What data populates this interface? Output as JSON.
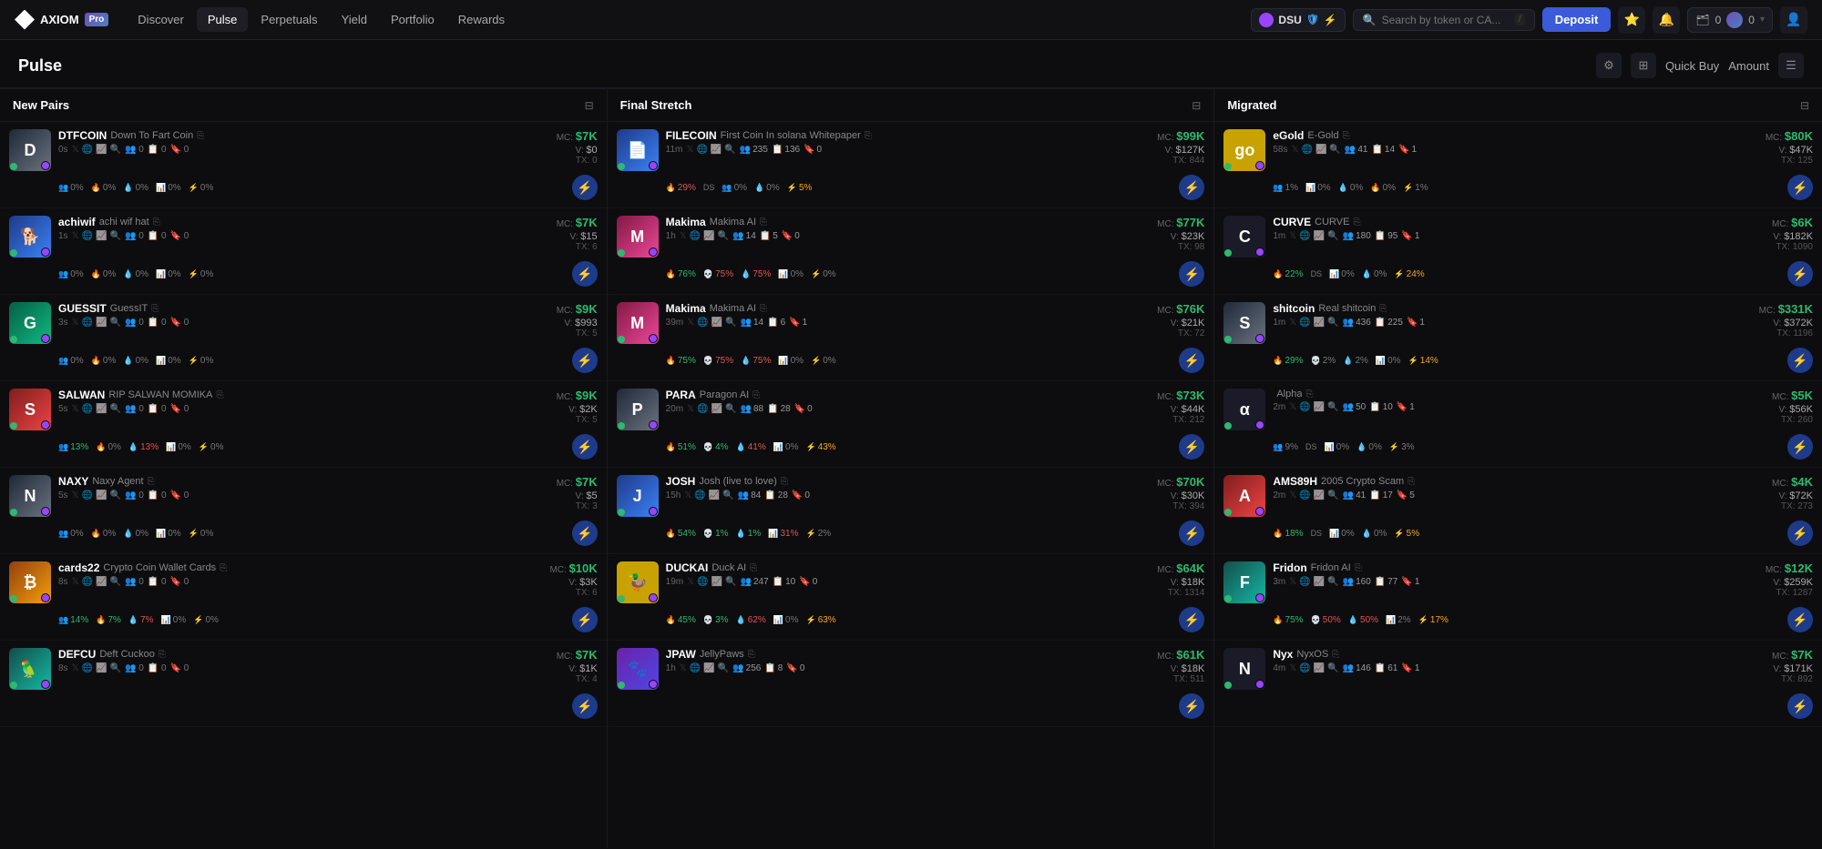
{
  "app": {
    "logo_text": "AXIOM",
    "logo_sub": "Pro",
    "nav_links": [
      "Discover",
      "Pulse",
      "Perpetuals",
      "Yield",
      "Portfolio",
      "Rewards"
    ],
    "active_nav": "Pulse",
    "chain": "DSU",
    "search_placeholder": "Search by token or CA...",
    "search_kbd": "/",
    "deposit_label": "Deposit",
    "wallet_bal1": "0",
    "wallet_bal2": "0"
  },
  "page": {
    "title": "Pulse",
    "quick_buy": "Quick Buy",
    "amount": "Amount"
  },
  "columns": [
    {
      "title": "New Pairs",
      "tokens": [
        {
          "ticker": "DTFCOIN",
          "fullname": "Down To Fart Coin",
          "time": "0s",
          "mc": "$7K",
          "vol": "$0",
          "vol_prefix": "V:",
          "tx": "TX: 0",
          "metrics": [
            {
              "icon": "👥",
              "val": "0%",
              "type": "neutral"
            },
            {
              "icon": "🔥",
              "val": "0%",
              "type": "neutral"
            },
            {
              "icon": "💧",
              "val": "0%",
              "type": "neutral"
            },
            {
              "icon": "📊",
              "val": "0%",
              "type": "neutral"
            },
            {
              "icon": "⚡",
              "val": "0%",
              "type": "neutral"
            }
          ],
          "avatar_text": "D",
          "avatar_class": "av-gray"
        },
        {
          "ticker": "achiwif",
          "fullname": "achi wif hat",
          "time": "1s",
          "mc": "$7K",
          "vol": "$15",
          "vol_prefix": "V:",
          "tx": "TX: 6",
          "metrics": [
            {
              "icon": "👥",
              "val": "0%",
              "type": "neutral"
            },
            {
              "icon": "🔥",
              "val": "0%",
              "type": "neutral"
            },
            {
              "icon": "💧",
              "val": "0%",
              "type": "neutral"
            },
            {
              "icon": "📊",
              "val": "0%",
              "type": "neutral"
            },
            {
              "icon": "⚡",
              "val": "0%",
              "type": "neutral"
            }
          ],
          "avatar_text": "🐕",
          "avatar_class": "av-blue"
        },
        {
          "ticker": "GUESSIT",
          "fullname": "GuessIT",
          "time": "3s",
          "mc": "$9K",
          "vol": "$993",
          "vol_prefix": "V:",
          "tx": "TX: 5",
          "metrics": [
            {
              "icon": "👥",
              "val": "0%",
              "type": "neutral"
            },
            {
              "icon": "🔥",
              "val": "0%",
              "type": "neutral"
            },
            {
              "icon": "💧",
              "val": "0%",
              "type": "neutral"
            },
            {
              "icon": "📊",
              "val": "0%",
              "type": "neutral"
            },
            {
              "icon": "⚡",
              "val": "0%",
              "type": "neutral"
            }
          ],
          "avatar_text": "G",
          "avatar_class": "av-green"
        },
        {
          "ticker": "SALWAN",
          "fullname": "RIP SALWAN MOMIKA",
          "time": "5s",
          "mc": "$9K",
          "vol": "$2K",
          "vol_prefix": "V:",
          "tx": "TX: 5",
          "metrics": [
            {
              "icon": "👥",
              "val": "13%",
              "type": "green"
            },
            {
              "icon": "🔥",
              "val": "0%",
              "type": "neutral"
            },
            {
              "icon": "💧",
              "val": "13%",
              "type": "red"
            },
            {
              "icon": "📊",
              "val": "0%",
              "type": "neutral"
            },
            {
              "icon": "⚡",
              "val": "0%",
              "type": "neutral"
            }
          ],
          "avatar_text": "S",
          "avatar_class": "av-red"
        },
        {
          "ticker": "NAXY",
          "fullname": "Naxy Agent",
          "time": "5s",
          "mc": "$7K",
          "vol": "$5",
          "vol_prefix": "V:",
          "tx": "TX: 3",
          "metrics": [
            {
              "icon": "👥",
              "val": "0%",
              "type": "neutral"
            },
            {
              "icon": "🔥",
              "val": "0%",
              "type": "neutral"
            },
            {
              "icon": "💧",
              "val": "0%",
              "type": "neutral"
            },
            {
              "icon": "📊",
              "val": "0%",
              "type": "neutral"
            },
            {
              "icon": "⚡",
              "val": "0%",
              "type": "neutral"
            }
          ],
          "avatar_text": "N",
          "avatar_class": "av-gray"
        },
        {
          "ticker": "cards22",
          "fullname": "Crypto Coin Wallet Cards",
          "time": "8s",
          "mc": "$10K",
          "vol": "$3K",
          "vol_prefix": "V:",
          "tx": "TX: 6",
          "metrics": [
            {
              "icon": "👥",
              "val": "14%",
              "type": "green"
            },
            {
              "icon": "🔥",
              "val": "7%",
              "type": "green"
            },
            {
              "icon": "💧",
              "val": "7%",
              "type": "red"
            },
            {
              "icon": "📊",
              "val": "0%",
              "type": "neutral"
            },
            {
              "icon": "⚡",
              "val": "0%",
              "type": "neutral"
            }
          ],
          "avatar_text": "₿",
          "avatar_class": "av-orange"
        },
        {
          "ticker": "DEFCU",
          "fullname": "Deft Cuckoo",
          "time": "8s",
          "mc": "$7K",
          "vol": "$1K",
          "vol_prefix": "V:",
          "tx": "TX: 4",
          "metrics": [],
          "avatar_text": "🦜",
          "avatar_class": "av-teal"
        }
      ]
    },
    {
      "title": "Final Stretch",
      "tokens": [
        {
          "ticker": "FILECOIN",
          "fullname": "First Coin In solana Whitepaper",
          "time": "11m",
          "mc": "$99K",
          "vol": "$127K",
          "vol_prefix": "V:",
          "tx": "TX: 844",
          "stat1": "235",
          "stat2": "136",
          "stat3": "0",
          "metrics": [
            {
              "icon": "🔥",
              "val": "29%",
              "type": "red"
            },
            {
              "icon": "DS",
              "val": "",
              "type": "neutral"
            },
            {
              "icon": "👥",
              "val": "0%",
              "type": "neutral"
            },
            {
              "icon": "💧",
              "val": "0%",
              "type": "neutral"
            },
            {
              "icon": "⚡",
              "val": "5%",
              "type": "orange"
            }
          ],
          "avatar_text": "📄",
          "avatar_class": "av-blue"
        },
        {
          "ticker": "Makima",
          "fullname": "Makima AI",
          "time": "1h",
          "mc": "$77K",
          "vol": "$23K",
          "vol_prefix": "V:",
          "tx": "TX: 98",
          "stat1": "14",
          "stat2": "5",
          "stat3": "0",
          "metrics": [
            {
              "icon": "🔥",
              "val": "76%",
              "type": "green"
            },
            {
              "icon": "💀",
              "val": "75%",
              "type": "red"
            },
            {
              "icon": "💧",
              "val": "75%",
              "type": "red"
            },
            {
              "icon": "📊",
              "val": "0%",
              "type": "neutral"
            },
            {
              "icon": "⚡",
              "val": "0%",
              "type": "neutral"
            }
          ],
          "avatar_text": "M",
          "avatar_class": "av-pink"
        },
        {
          "ticker": "Makima",
          "fullname": "Makima AI",
          "time": "39m",
          "mc": "$76K",
          "vol": "$21K",
          "vol_prefix": "V:",
          "tx": "TX: 72",
          "stat1": "14",
          "stat2": "6",
          "stat3": "1",
          "metrics": [
            {
              "icon": "🔥",
              "val": "75%",
              "type": "green"
            },
            {
              "icon": "💀",
              "val": "75%",
              "type": "red"
            },
            {
              "icon": "💧",
              "val": "75%",
              "type": "red"
            },
            {
              "icon": "📊",
              "val": "0%",
              "type": "neutral"
            },
            {
              "icon": "⚡",
              "val": "0%",
              "type": "neutral"
            }
          ],
          "avatar_text": "M",
          "avatar_class": "av-pink"
        },
        {
          "ticker": "PARA",
          "fullname": "Paragon AI",
          "time": "20m",
          "mc": "$73K",
          "vol": "$44K",
          "vol_prefix": "V:",
          "tx": "TX: 212",
          "stat1": "88",
          "stat2": "28",
          "stat3": "0",
          "metrics": [
            {
              "icon": "🔥",
              "val": "51%",
              "type": "green"
            },
            {
              "icon": "💀",
              "val": "4%",
              "type": "green"
            },
            {
              "icon": "💧",
              "val": "41%",
              "type": "red"
            },
            {
              "icon": "📊",
              "val": "0%",
              "type": "neutral"
            },
            {
              "icon": "⚡",
              "val": "43%",
              "type": "orange"
            }
          ],
          "avatar_text": "P",
          "avatar_class": "av-gray"
        },
        {
          "ticker": "JOSH",
          "fullname": "Josh (live to love)",
          "time": "15h",
          "mc": "$70K",
          "vol": "$30K",
          "vol_prefix": "V:",
          "tx": "TX: 394",
          "stat1": "84",
          "stat2": "28",
          "stat3": "0",
          "metrics": [
            {
              "icon": "🔥",
              "val": "54%",
              "type": "green"
            },
            {
              "icon": "💀",
              "val": "1%",
              "type": "green"
            },
            {
              "icon": "💧",
              "val": "1%",
              "type": "green"
            },
            {
              "icon": "📊",
              "val": "31%",
              "type": "red"
            },
            {
              "icon": "⚡",
              "val": "2%",
              "type": "neutral"
            }
          ],
          "avatar_text": "J",
          "avatar_class": "av-blue"
        },
        {
          "ticker": "DUCKAI",
          "fullname": "Duck AI",
          "time": "19m",
          "mc": "$64K",
          "vol": "$18K",
          "vol_prefix": "V:",
          "tx": "TX: 1314",
          "stat1": "247",
          "stat2": "10",
          "stat3": "0",
          "metrics": [
            {
              "icon": "🔥",
              "val": "45%",
              "type": "green"
            },
            {
              "icon": "💀",
              "val": "3%",
              "type": "green"
            },
            {
              "icon": "💧",
              "val": "62%",
              "type": "red"
            },
            {
              "icon": "📊",
              "val": "0%",
              "type": "neutral"
            },
            {
              "icon": "⚡",
              "val": "63%",
              "type": "orange"
            }
          ],
          "avatar_text": "🦆",
          "avatar_class": "av-yellow"
        },
        {
          "ticker": "JPAW",
          "fullname": "JellyPaws",
          "time": "1h",
          "mc": "$61K",
          "vol": "$18K",
          "vol_prefix": "V:",
          "tx": "TX: 511",
          "stat1": "256",
          "stat2": "8",
          "stat3": "0",
          "metrics": [],
          "avatar_text": "🐾",
          "avatar_class": "av-purple"
        }
      ]
    },
    {
      "title": "Migrated",
      "tokens": [
        {
          "ticker": "eGold",
          "fullname": "E-Gold",
          "time": "58s",
          "mc": "$80K",
          "mc_color": "green",
          "vol": "$47K",
          "vol_prefix": "V:",
          "tx": "TX: 125",
          "stat1": "41",
          "stat2": "14",
          "stat3": "1",
          "metrics": [
            {
              "icon": "👥",
              "val": "1%",
              "type": "neutral"
            },
            {
              "icon": "📊",
              "val": "0%",
              "type": "neutral"
            },
            {
              "icon": "💧",
              "val": "0%",
              "type": "neutral"
            },
            {
              "icon": "🔥",
              "val": "0%",
              "type": "neutral"
            },
            {
              "icon": "⚡",
              "val": "1%",
              "type": "neutral"
            }
          ],
          "avatar_text": "go",
          "avatar_class": "av-yellow"
        },
        {
          "ticker": "CURVE",
          "fullname": "CURVE",
          "time": "1m",
          "mc": "$6K",
          "mc_color": "green",
          "vol": "$182K",
          "vol_prefix": "V:",
          "tx": "TX: 1090",
          "stat1": "180",
          "stat2": "95",
          "stat3": "1",
          "metrics": [
            {
              "icon": "🔥",
              "val": "22%",
              "type": "green"
            },
            {
              "icon": "DS",
              "val": "",
              "type": "neutral"
            },
            {
              "icon": "📊",
              "val": "0%",
              "type": "neutral"
            },
            {
              "icon": "💧",
              "val": "0%",
              "type": "neutral"
            },
            {
              "icon": "⚡",
              "val": "24%",
              "type": "orange"
            }
          ],
          "avatar_text": "C",
          "avatar_class": "av-dark"
        },
        {
          "ticker": "shitcoin",
          "fullname": "Real shitcoin",
          "time": "1m",
          "mc": "$331K",
          "mc_color": "green",
          "vol": "$372K",
          "vol_prefix": "V:",
          "tx": "TX: 1196",
          "stat1": "436",
          "stat2": "225",
          "stat3": "1",
          "metrics": [
            {
              "icon": "🔥",
              "val": "29%",
              "type": "green"
            },
            {
              "icon": "💀",
              "val": "2%",
              "type": "neutral"
            },
            {
              "icon": "💧",
              "val": "2%",
              "type": "neutral"
            },
            {
              "icon": "📊",
              "val": "0%",
              "type": "neutral"
            },
            {
              "icon": "⚡",
              "val": "14%",
              "type": "orange"
            }
          ],
          "avatar_text": "S",
          "avatar_class": "av-gray"
        },
        {
          "ticker": "",
          "fullname": "Alpha",
          "time": "2m",
          "mc": "$5K",
          "mc_color": "green",
          "vol": "$56K",
          "vol_prefix": "V:",
          "tx": "TX: 260",
          "stat1": "50",
          "stat2": "10",
          "stat3": "1",
          "metrics": [
            {
              "icon": "👥",
              "val": "9%",
              "type": "neutral"
            },
            {
              "icon": "DS",
              "val": "",
              "type": "neutral"
            },
            {
              "icon": "📊",
              "val": "0%",
              "type": "neutral"
            },
            {
              "icon": "💧",
              "val": "0%",
              "type": "neutral"
            },
            {
              "icon": "⚡",
              "val": "3%",
              "type": "neutral"
            }
          ],
          "avatar_text": "α",
          "avatar_class": "av-dark"
        },
        {
          "ticker": "AMS89H",
          "fullname": "2005 Crypto Scam",
          "time": "2m",
          "mc": "$4K",
          "mc_color": "green",
          "vol": "$72K",
          "vol_prefix": "V:",
          "tx": "TX: 273",
          "stat1": "41",
          "stat2": "17",
          "stat3": "5",
          "metrics": [
            {
              "icon": "🔥",
              "val": "18%",
              "type": "green"
            },
            {
              "icon": "DS",
              "val": "",
              "type": "neutral"
            },
            {
              "icon": "📊",
              "val": "0%",
              "type": "neutral"
            },
            {
              "icon": "💧",
              "val": "0%",
              "type": "neutral"
            },
            {
              "icon": "⚡",
              "val": "5%",
              "type": "orange"
            }
          ],
          "avatar_text": "A",
          "avatar_class": "av-red"
        },
        {
          "ticker": "Fridon",
          "fullname": "Fridon AI",
          "time": "3m",
          "mc": "$12K",
          "mc_color": "green",
          "vol": "$259K",
          "vol_prefix": "V:",
          "tx": "TX: 1287",
          "stat1": "160",
          "stat2": "77",
          "stat3": "1",
          "metrics": [
            {
              "icon": "🔥",
              "val": "75%",
              "type": "green"
            },
            {
              "icon": "💀",
              "val": "50%",
              "type": "red"
            },
            {
              "icon": "💧",
              "val": "50%",
              "type": "red"
            },
            {
              "icon": "📊",
              "val": "2%",
              "type": "neutral"
            },
            {
              "icon": "⚡",
              "val": "17%",
              "type": "orange"
            }
          ],
          "avatar_text": "F",
          "avatar_class": "av-teal"
        },
        {
          "ticker": "Nyx",
          "fullname": "NyxOS",
          "time": "4m",
          "mc": "$7K",
          "mc_color": "green",
          "vol": "$171K",
          "vol_prefix": "V:",
          "tx": "TX: 892",
          "stat1": "146",
          "stat2": "61",
          "stat3": "1",
          "metrics": [],
          "avatar_text": "N",
          "avatar_class": "av-dark"
        }
      ]
    }
  ]
}
